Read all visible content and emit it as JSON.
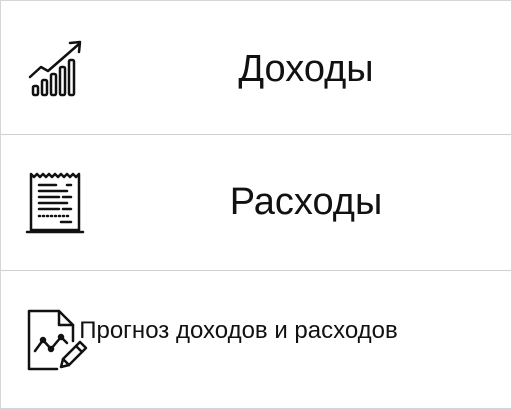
{
  "menu": {
    "items": [
      {
        "label": "Доходы",
        "icon": "growth-chart-icon"
      },
      {
        "label": "Расходы",
        "icon": "receipt-icon"
      },
      {
        "label": "Прогноз доходов и расходов",
        "icon": "forecast-document-icon"
      }
    ]
  },
  "colors": {
    "background": "#ffffff",
    "text": "#111111",
    "divider": "#cfcfcf"
  }
}
